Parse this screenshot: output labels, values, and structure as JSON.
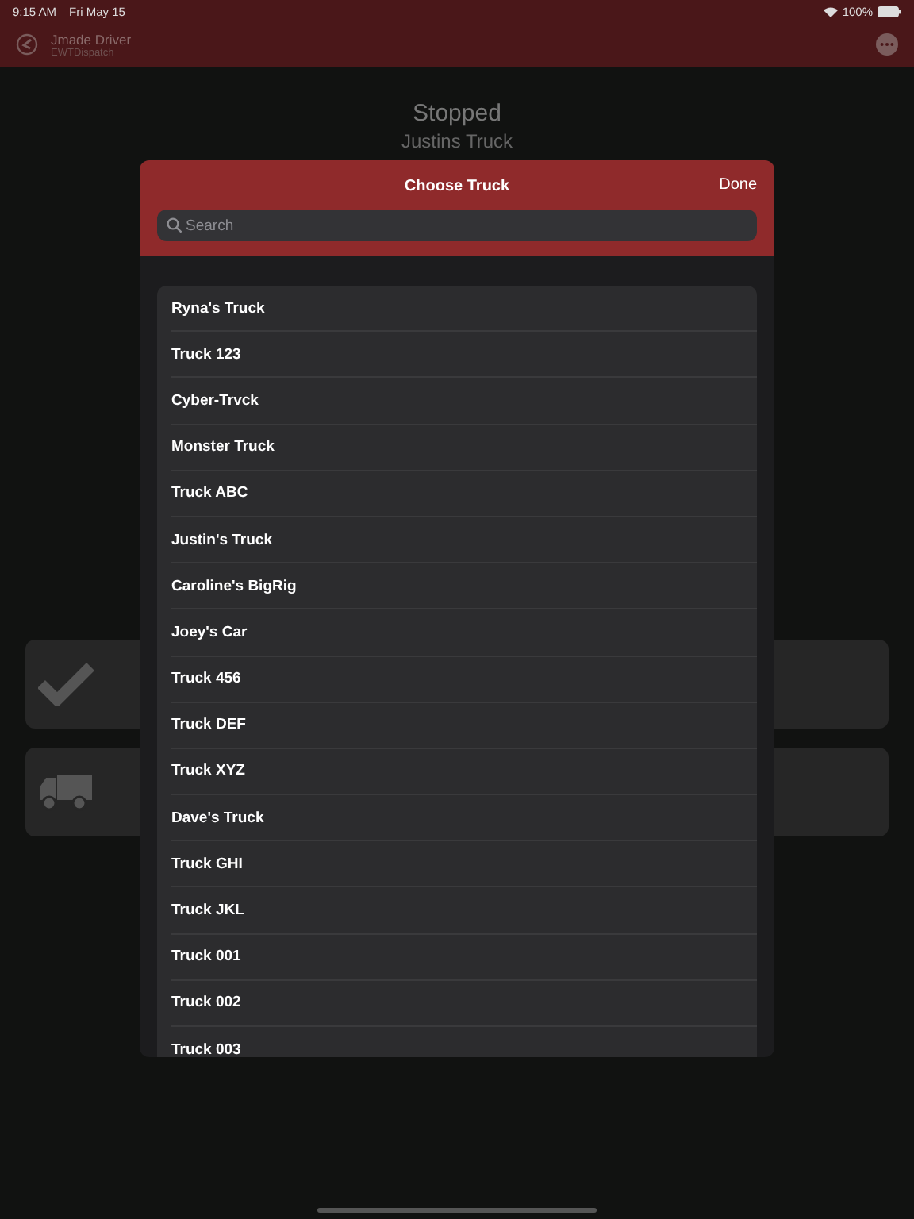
{
  "status_bar": {
    "time": "9:15 AM",
    "date": "Fri May 15",
    "battery": "100%"
  },
  "nav_bar": {
    "title": "Jmade Driver",
    "subtitle": "EWTDispatch"
  },
  "header": {
    "status": "Stopped",
    "truck": "Justins Truck"
  },
  "action_cards": [
    {
      "kind": "check"
    },
    {
      "kind": "truck"
    }
  ],
  "sheet": {
    "title": "Choose Truck",
    "done": "Done",
    "search": {
      "placeholder": "Search"
    },
    "trucks": [
      "Ryna's Truck",
      "Truck 123",
      "Cyber-Trvck",
      "Monster Truck",
      "Truck ABC",
      "Justin's Truck",
      "Caroline's BigRig",
      "Joey's Car",
      "Truck 456",
      "Truck DEF",
      "Truck XYZ",
      "Dave's Truck",
      "Truck GHI",
      "Truck JKL",
      "Truck 001",
      "Truck 002",
      "Truck 003"
    ]
  }
}
